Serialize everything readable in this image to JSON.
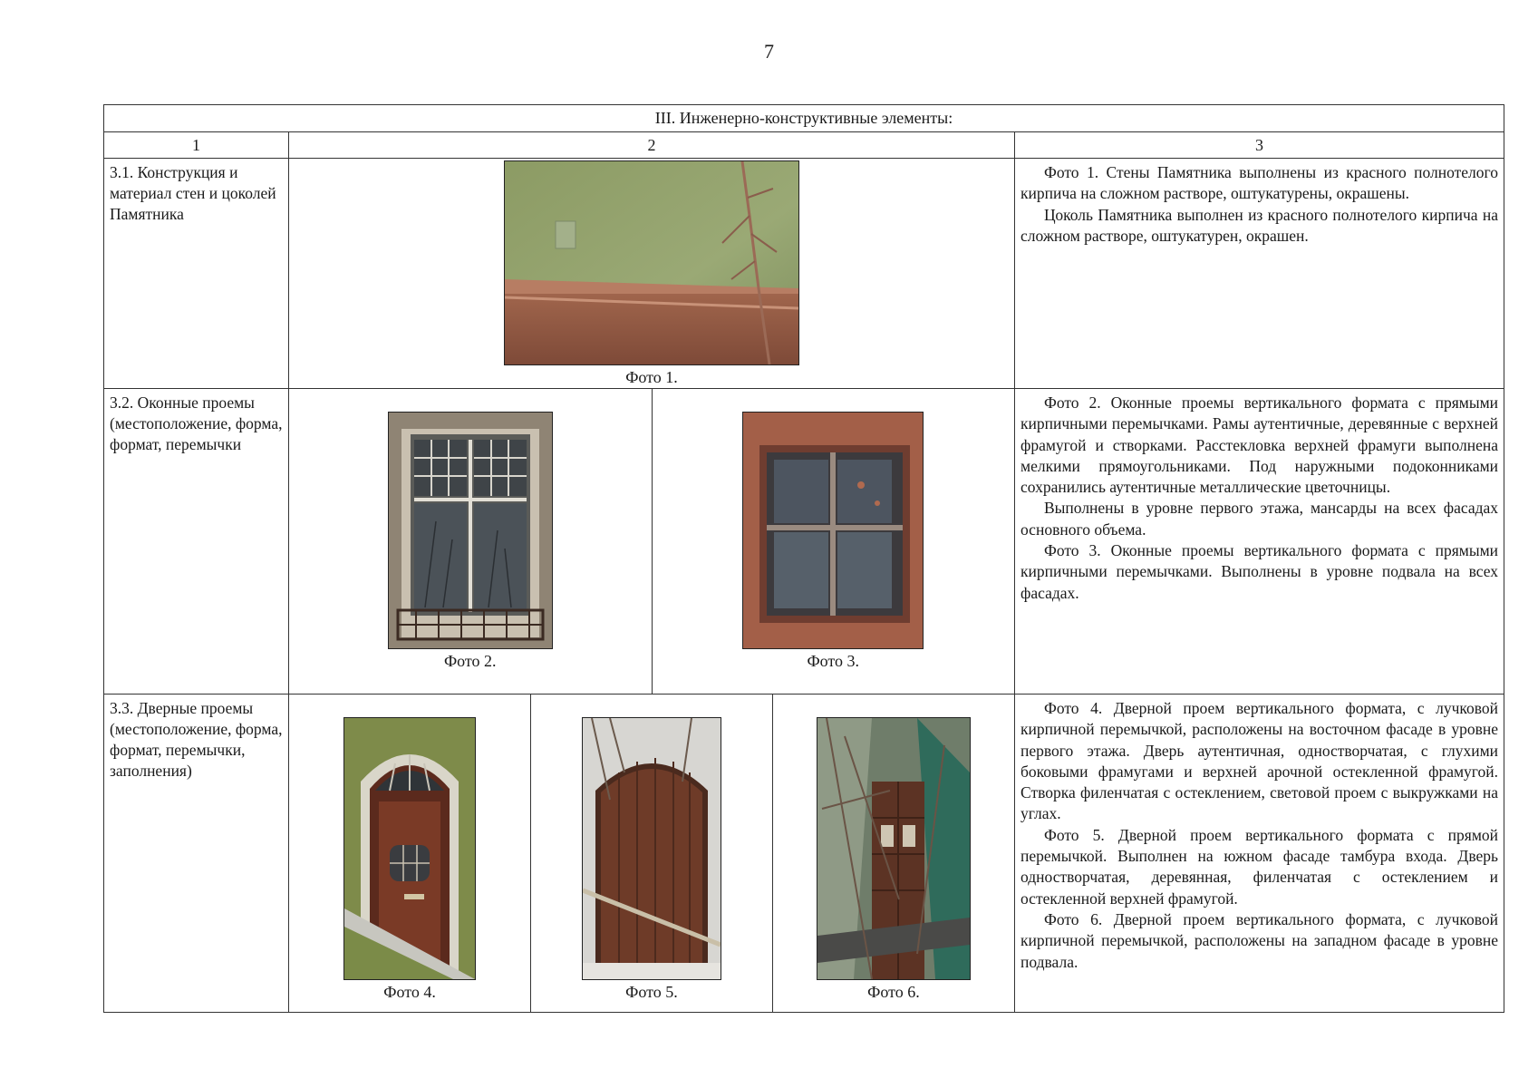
{
  "page_number": "7",
  "section_title": "III.  Инженерно-конструктивные элементы:",
  "column_numbers": [
    "1",
    "2",
    "3"
  ],
  "rows": [
    {
      "label": "3.1.  Конструкция и материал стен и цоколей Памятника",
      "photos": [
        {
          "caption": "Фото 1.",
          "icon": "wall-plinth-photo"
        }
      ],
      "description": [
        "Фото 1.  Стены Памятника выполнены из красного полнотелого кирпича на сложном растворе, оштукатурены, окрашены.",
        "Цоколь Памятника выполнен из красного полнотелого кирпича на сложном растворе, оштукатурен, окрашен."
      ]
    },
    {
      "label": "3.2. Оконные проемы (местоположение, форма, формат, перемычки",
      "photos": [
        {
          "caption": "Фото 2.",
          "icon": "window-flowerbox-photo"
        },
        {
          "caption": "Фото 3.",
          "icon": "basement-window-photo"
        }
      ],
      "description": [
        "Фото 2. Оконные проемы вертикального формата с прямыми кирпичными перемычками.  Рамы аутентичные, деревянные с верхней фрамугой и створками. Расстекловка верхней фрамуги выполнена мелкими прямоугольниками. Под наружными подоконниками сохранились аутентичные металлические цветочницы.",
        "Выполнены в уровне первого этажа, мансарды на всех фасадах основного объема.",
        "Фото 3.  Оконные проемы вертикального формата с прямыми кирпичными перемычками. Выполнены в уровне подвала на всех фасадах."
      ]
    },
    {
      "label": "3.3. Дверные проемы (местоположение, форма, формат, перемычки, заполнения)",
      "photos": [
        {
          "caption": "Фото 4.",
          "icon": "arched-door-photo"
        },
        {
          "caption": "Фото 5.",
          "icon": "plank-door-photo"
        },
        {
          "caption": "Фото 6.",
          "icon": "basement-door-photo"
        }
      ],
      "description": [
        "Фото 4. Дверной проем вертикального формата, с лучковой кирпичной перемычкой, расположены на восточном фасаде в уровне первого этажа. Дверь аутентичная, одностворчатая, с глухими боковыми фрамугами и верхней арочной остекленной фрамугой. Створка филенчатая с остеклением, световой проем с выкружками на углах.",
        "Фото 5.  Дверной проем вертикального формата с прямой перемычкой. Выполнен на южном фасаде тамбура входа. Дверь одностворчатая, деревянная, филенчатая с остеклением и остекленной верхней фрамугой.",
        "Фото 6.  Дверной проем вертикального формата, с лучковой кирпичной перемычкой, расположены на западном фасаде в уровне подвала."
      ]
    }
  ]
}
